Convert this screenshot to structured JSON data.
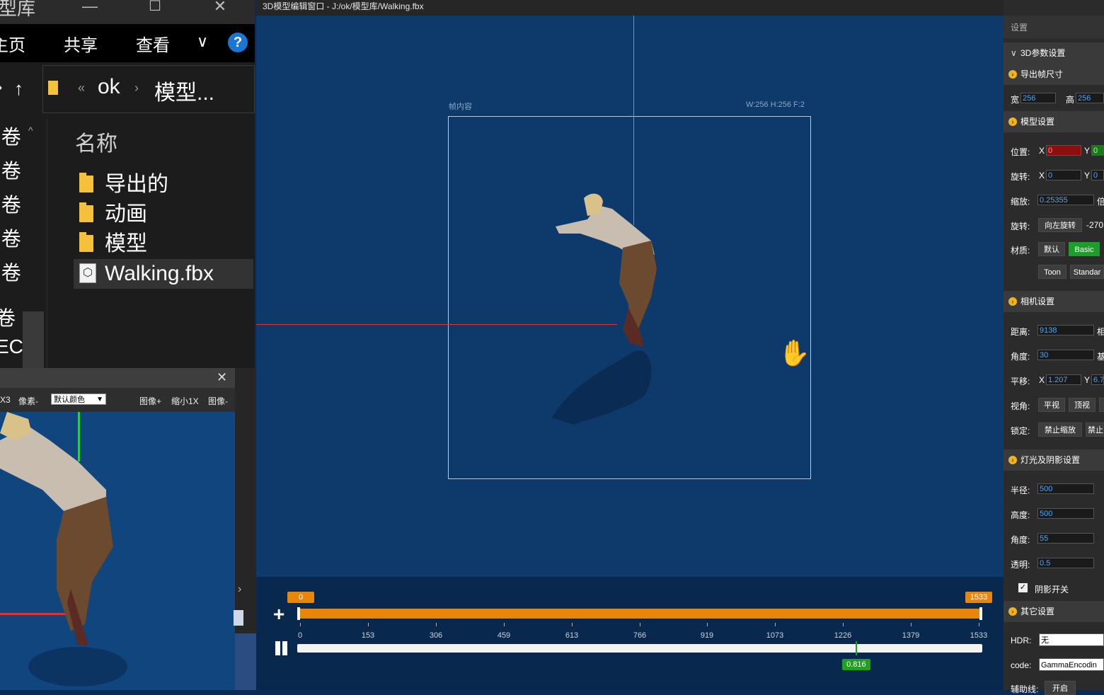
{
  "explorer": {
    "title": "型库",
    "win_minimize": "—",
    "win_maximize": "☐",
    "win_close": "✕",
    "ribbon_tabs": [
      "主页",
      "共享",
      "查看"
    ],
    "help": "?",
    "chevron": "∨",
    "up": "↑",
    "breadcrumb": [
      "ok",
      "模型..."
    ],
    "breadcrumb_left_sep": "«",
    "breadcrumb_sep": "›",
    "nav_items": [
      "]卷",
      "]卷",
      "]卷",
      "]卷",
      "]卷",
      "卷",
      "ECY"
    ],
    "column_header": "名称",
    "files": [
      {
        "name": "导出的",
        "type": "folder"
      },
      {
        "name": "动画",
        "type": "folder"
      },
      {
        "name": "模型",
        "type": "folder"
      },
      {
        "name": "Walking.fbx",
        "type": "file"
      }
    ]
  },
  "preview": {
    "close": "✕",
    "toolbar": {
      "x3": "X3",
      "pixel_minus": "像素-",
      "color_select": "默认颜色",
      "image_plus": "图像+",
      "shrink": "缩小1X",
      "image_minus": "图像-"
    }
  },
  "editor": {
    "title": "3D模型编辑窗口 - J:/ok/模型库/Walking.fbx",
    "frame_label": "帧内容",
    "frame_size": "W:256 H:256 F:2"
  },
  "timeline": {
    "add": "+",
    "start": "0",
    "end": "1533",
    "ticks": [
      "0",
      "153",
      "306",
      "459",
      "613",
      "766",
      "919",
      "1073",
      "1226",
      "1379",
      "1533"
    ],
    "progress": 0.816,
    "progress_label": "0.816"
  },
  "settings": {
    "title": "设置",
    "section_3d": "3D参数设置",
    "export_frame": {
      "title": "导出帧尺寸",
      "width_label": "宽",
      "width": "256",
      "height_label": "高",
      "height": "256"
    },
    "model": {
      "title": "模型设置",
      "position_label": "位置:",
      "pos_x": "0",
      "pos_y": "0",
      "rotation_label": "旋转:",
      "rot_x": "0",
      "rot_y": "0",
      "scale_label": "缩放:",
      "scale": "0.25355",
      "scale_unit": "倍",
      "rotate2_label": "旋转:",
      "rotate_left": "向左旋转",
      "rotate_value": "-270",
      "material_label": "材质:",
      "mat_default": "默认",
      "mat_basic": "Basic",
      "mat_toon": "Toon",
      "mat_standard": "Standar"
    },
    "camera": {
      "title": "相机设置",
      "distance_label": "距离:",
      "distance": "9138",
      "distance_suffix": "相",
      "angle_label": "角度:",
      "angle": "30",
      "angle_suffix": "基",
      "pan_label": "平移:",
      "pan_x": "1.207",
      "pan_y": "6.7",
      "view_label": "视角:",
      "view_flat": "平视",
      "view_top": "顶视",
      "lock_label": "锁定:",
      "lock_zoom": "禁止缩放",
      "lock_more": "禁止"
    },
    "light": {
      "title": "灯光及阴影设置",
      "radius_label": "半径:",
      "radius": "500",
      "height_label": "高度:",
      "height": "500",
      "angle_label": "角度:",
      "angle": "55",
      "alpha_label": "透明:",
      "alpha": "0.5",
      "shadow_label": "阴影开关",
      "shadow_checked": "✓"
    },
    "other": {
      "title": "其它设置",
      "hdr_label": "HDR:",
      "hdr": "无",
      "code_label": "code:",
      "code": "GammaEncodin",
      "aux_label": "辅助线:",
      "aux": "开启"
    }
  },
  "colors": {
    "viewport": "#0d3a6b",
    "accent_orange": "#e8860c",
    "accent_green": "#1e9c2c"
  }
}
